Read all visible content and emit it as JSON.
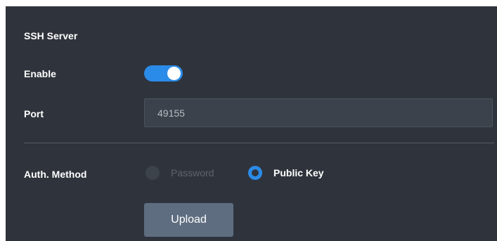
{
  "section": {
    "title": "SSH Server"
  },
  "enable": {
    "label": "Enable",
    "state": "on",
    "color": "#2b8be8"
  },
  "port": {
    "label": "Port",
    "value": "49155"
  },
  "auth": {
    "label": "Auth. Method",
    "options": [
      {
        "label": "Password",
        "state": "disabled"
      },
      {
        "label": "Public Key",
        "state": "selected"
      }
    ]
  },
  "upload": {
    "label": "Upload"
  },
  "colors": {
    "panel_background": "#2f343c",
    "accent": "#2b8be8",
    "button_background": "#5f6d80"
  }
}
